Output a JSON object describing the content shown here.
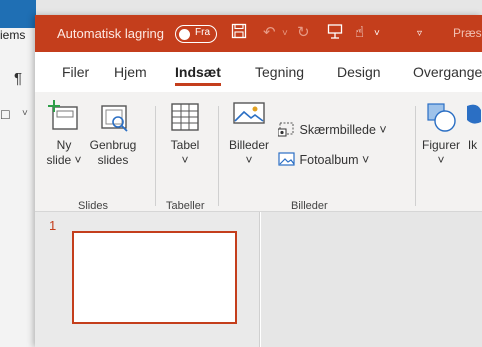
{
  "background_window": {
    "title_fragment": "iems",
    "pilcrow": "¶"
  },
  "titlebar": {
    "autosave_label": "Automatisk lagring",
    "autosave_toggle": "Fra",
    "doc_name": "Præs"
  },
  "tabs": [
    "Filer",
    "Hjem",
    "Indsæt",
    "Tegning",
    "Design",
    "Overgange"
  ],
  "ribbon": {
    "new_slide": [
      "Ny",
      "slide ˅"
    ],
    "reuse": [
      "Genbrug",
      "slides"
    ],
    "table": "Tabel",
    "images": "Billeder",
    "screenshot": "Skærmbillede ˅",
    "photoalbum": "Fotoalbum ˅",
    "shapes": "Figurer",
    "icons": "Ik",
    "groups": {
      "slides": "Slides",
      "tables": "Tabeller",
      "images": "Billeder"
    }
  },
  "slide_panel": {
    "slide_number": "1"
  },
  "colors": {
    "accent": "#c43e1c",
    "ribbon": "#f3f2f1"
  }
}
